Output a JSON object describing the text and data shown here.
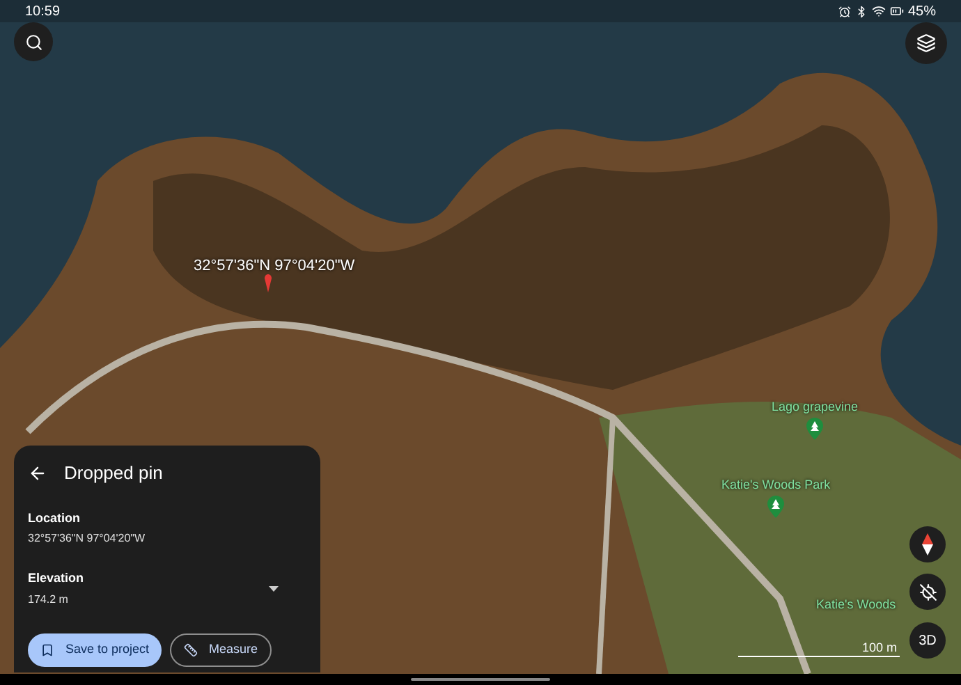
{
  "status_bar": {
    "time": "10:59",
    "battery": "45%"
  },
  "map": {
    "pin_label": "32°57'36\"N 97°04'20\"W",
    "places": [
      {
        "name": "Lago grapevine",
        "kind": "pin"
      },
      {
        "name": "Katie's Woods Park",
        "kind": "pin"
      },
      {
        "name": "Katie's Woods",
        "kind": "label"
      }
    ],
    "scale": "100 m",
    "view_button": "3D"
  },
  "panel": {
    "title": "Dropped pin",
    "fields": [
      {
        "label": "Location",
        "value": "32°57'36\"N 97°04'20\"W",
        "expandable": false
      },
      {
        "label": "Elevation",
        "value": "174.2 m",
        "expandable": true
      }
    ],
    "buttons": [
      {
        "label": "Save to project",
        "kind": "primary"
      },
      {
        "label": "Measure",
        "kind": "outline"
      }
    ]
  }
}
